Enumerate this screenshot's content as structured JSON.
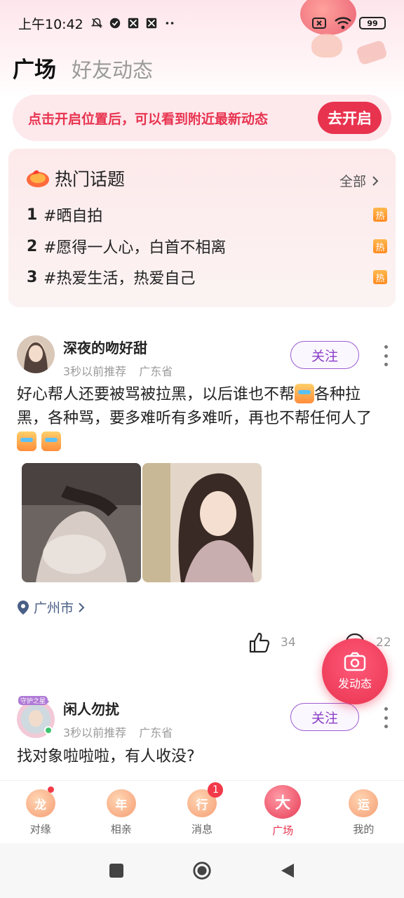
{
  "status_bar": {
    "time": "上午10:42",
    "battery": "99"
  },
  "tabs": [
    {
      "label": "广场"
    },
    {
      "label": "好友动态"
    }
  ],
  "location_banner": {
    "text": "点击开启位置后，可以看到附近最新动态",
    "button": "去开启"
  },
  "hot_topics": {
    "title": "热门话题",
    "all_label": "全部",
    "badge": "热",
    "items": [
      {
        "rank": "1",
        "text": "#晒自拍"
      },
      {
        "rank": "2",
        "text": "#愿得一人心，白首不相离"
      },
      {
        "rank": "3",
        "text": "#热爱生活，热爱自己"
      }
    ]
  },
  "posts": [
    {
      "username": "深夜的吻好甜",
      "time": "3秒以前推荐",
      "region": "广东省",
      "follow": "关注",
      "text": "好心帮人还要被骂被拉黑，以后谁也不帮",
      "text2": "各种拉黑，各种骂，要多难听有多难听，再也不帮任何人了",
      "location": "广州市",
      "likes": "34",
      "comments": "22"
    },
    {
      "username": "闲人勿扰",
      "frame_label": "守护之星",
      "time": "3秒以前推荐",
      "region": "广东省",
      "follow": "关注",
      "text": "找对象啦啦啦，有人收没?"
    }
  ],
  "fab": {
    "label": "发动态"
  },
  "bottom_nav": [
    {
      "icon_char": "龙",
      "label": "对缘"
    },
    {
      "icon_char": "年",
      "label": "相亲"
    },
    {
      "icon_char": "行",
      "label": "消息",
      "badge": "1"
    },
    {
      "icon_char": "大",
      "label": "广场"
    },
    {
      "icon_char": "运",
      "label": "我的"
    }
  ],
  "colors": {
    "accent": "#e8334f",
    "follow": "#8a3dc6",
    "location": "#4a5f86"
  }
}
